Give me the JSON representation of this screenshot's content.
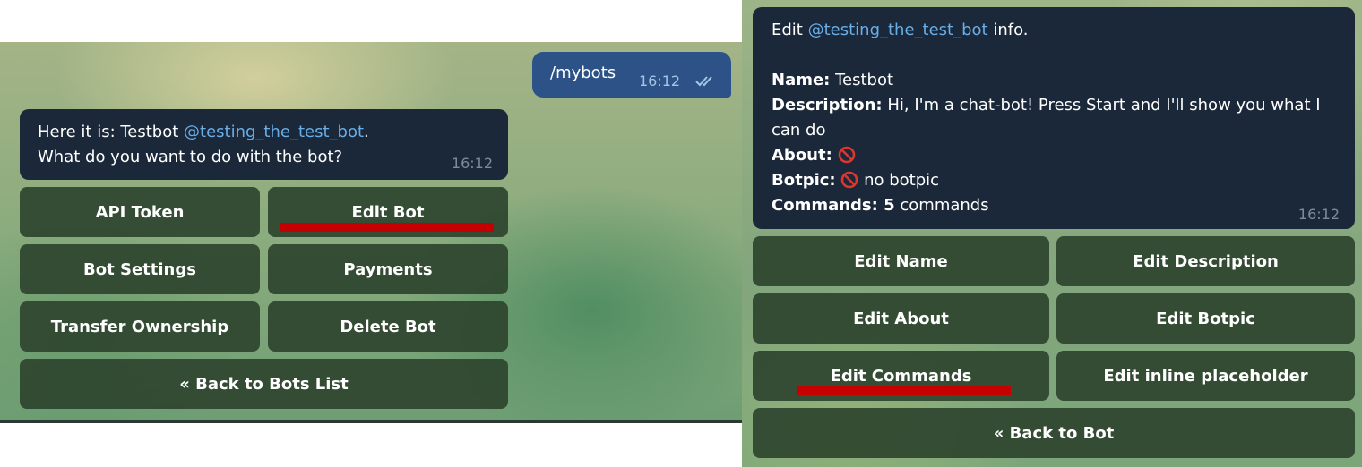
{
  "left_chat": {
    "outgoing": {
      "text": "/mybots",
      "time": "16:12"
    },
    "bot_message": {
      "line1_prefix": "Here it is: Testbot ",
      "username": "@testing_the_test_bot",
      "line1_suffix": ".",
      "line2": "What do you want to do with the bot?",
      "time": "16:12"
    },
    "buttons": {
      "api_token": "API Token",
      "edit_bot": "Edit Bot",
      "bot_settings": "Bot Settings",
      "payments": "Payments",
      "transfer_ownership": "Transfer Ownership",
      "delete_bot": "Delete Bot",
      "back_to_bots_list": "« Back to Bots List"
    }
  },
  "right_chat": {
    "bot_message": {
      "intro_prefix": "Edit ",
      "username": "@testing_the_test_bot",
      "intro_suffix": " info.",
      "name_label": "Name:",
      "name_value": " Testbot",
      "description_label": "Description:",
      "description_value": " Hi, I'm a chat-bot! Press Start and I'll show you what I can do",
      "about_label": "About:",
      "botpic_label": "Botpic:",
      "botpic_value": " no botpic",
      "commands_label": "Commands:",
      "commands_count": " 5",
      "commands_value": " commands",
      "time": "16:12"
    },
    "buttons": {
      "edit_name": "Edit Name",
      "edit_description": "Edit Description",
      "edit_about": "Edit About",
      "edit_botpic": "Edit Botpic",
      "edit_commands": "Edit Commands",
      "edit_inline_placeholder": "Edit inline placeholder",
      "back_to_bot": "« Back to Bot"
    }
  },
  "icons": {
    "read_ticks": "double-check-icon",
    "not_set": "prohibited-icon"
  },
  "colors": {
    "bubble_incoming": "#1b2839",
    "bubble_outgoing": "#2c5288",
    "link": "#68aee8",
    "button_bg": "#2e442e",
    "highlight": "#c40000"
  }
}
